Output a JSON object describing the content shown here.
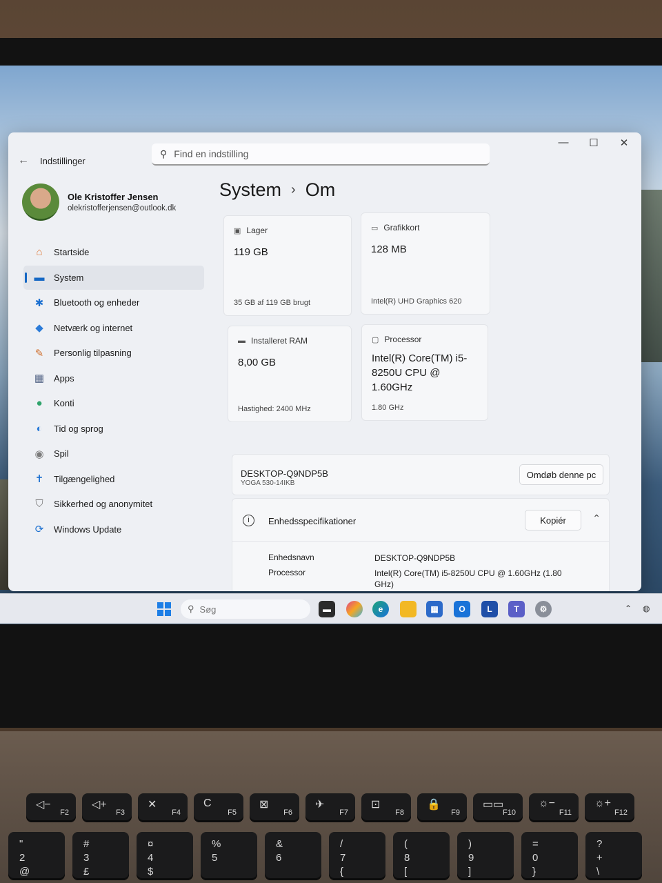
{
  "window": {
    "app_title": "Indstillinger",
    "back_icon": "←",
    "minimize": "—",
    "maximize": "☐",
    "close": "✕"
  },
  "search": {
    "placeholder": "Find en indstilling",
    "icon": "search-icon"
  },
  "profile": {
    "name": "Ole Kristoffer Jensen",
    "email": "olekristofferjensen@outlook.dk"
  },
  "nav": [
    {
      "label": "Startside",
      "icon": "home-icon",
      "glyph": "⌂",
      "color": "#e07a3a"
    },
    {
      "label": "System",
      "icon": "monitor-icon",
      "glyph": "▬",
      "color": "#1668c4"
    },
    {
      "label": "Bluetooth og enheder",
      "icon": "bluetooth-icon",
      "glyph": "✱",
      "color": "#1a6fd0"
    },
    {
      "label": "Netværk og internet",
      "icon": "wifi-icon",
      "glyph": "◆",
      "color": "#2b7bd8"
    },
    {
      "label": "Personlig tilpasning",
      "icon": "brush-icon",
      "glyph": "✎",
      "color": "#d0702e"
    },
    {
      "label": "Apps",
      "icon": "apps-icon",
      "glyph": "▦",
      "color": "#5a6a8a"
    },
    {
      "label": "Konti",
      "icon": "account-icon",
      "glyph": "●",
      "color": "#2fa36b"
    },
    {
      "label": "Tid og sprog",
      "icon": "globe-clock-icon",
      "glyph": "◐",
      "color": "#2b7bd8"
    },
    {
      "label": "Spil",
      "icon": "gamepad-icon",
      "glyph": "◉",
      "color": "#7a7a7a"
    },
    {
      "label": "Tilgængelighed",
      "icon": "accessibility-icon",
      "glyph": "✝",
      "color": "#1a6fd0"
    },
    {
      "label": "Sikkerhed og anonymitet",
      "icon": "shield-icon",
      "glyph": "⛉",
      "color": "#777"
    },
    {
      "label": "Windows Update",
      "icon": "update-icon",
      "glyph": "⟳",
      "color": "#1a6fd0"
    }
  ],
  "nav_active_index": 1,
  "breadcrumb": {
    "parent": "System",
    "separator": "›",
    "current": "Om"
  },
  "cards": {
    "storage": {
      "title": "Lager",
      "value": "119 GB",
      "sub": "35 GB af 119 GB brugt"
    },
    "graphics": {
      "title": "Grafikkort",
      "value": "128 MB",
      "sub": "Intel(R) UHD Graphics 620"
    },
    "ram": {
      "title": "Installeret RAM",
      "value": "8,00 GB",
      "sub": "Hastighed: 2400 MHz"
    },
    "cpu": {
      "title": "Processor",
      "value": "Intel(R) Core(TM) i5-8250U CPU @ 1.60GHz",
      "sub": "1.80 GHz"
    }
  },
  "device": {
    "name": "DESKTOP-Q9NDP5B",
    "model": "YOGA 530-14IKB",
    "rename_button": "Omdøb denne pc"
  },
  "specs": {
    "title": "Enhedsspecifikationer",
    "copy_button": "Kopiér",
    "rows": [
      {
        "label": "Enhedsnavn",
        "value": "DESKTOP-Q9NDP5B"
      },
      {
        "label": "Processor",
        "value": "Intel(R) Core(TM) i5-8250U CPU @ 1.60GHz (1.80 GHz)"
      }
    ]
  },
  "taskbar": {
    "search_placeholder": "Søg"
  },
  "keyboard": {
    "fkeys": [
      {
        "sym": "◁−",
        "fn": "F2"
      },
      {
        "sym": "◁+",
        "fn": "F3"
      },
      {
        "sym": "✕",
        "fn": "F4"
      },
      {
        "sym": "C",
        "fn": "F5"
      },
      {
        "sym": "⊠",
        "fn": "F6"
      },
      {
        "sym": "✈",
        "fn": "F7"
      },
      {
        "sym": "⊡",
        "fn": "F8"
      },
      {
        "sym": "🔒",
        "fn": "F9"
      },
      {
        "sym": "▭▭",
        "fn": "F10"
      },
      {
        "sym": "☼−",
        "fn": "F11"
      },
      {
        "sym": "☼+",
        "fn": "F12"
      }
    ],
    "numkeys": [
      "\"\n2\n@",
      "#\n3\n£",
      "¤\n4\n$",
      "%\n5",
      "&\n6",
      "/\n7\n{",
      "(\n8\n[",
      ")\n9\n]",
      "=\n0\n}",
      "?\n+\n\\"
    ]
  }
}
